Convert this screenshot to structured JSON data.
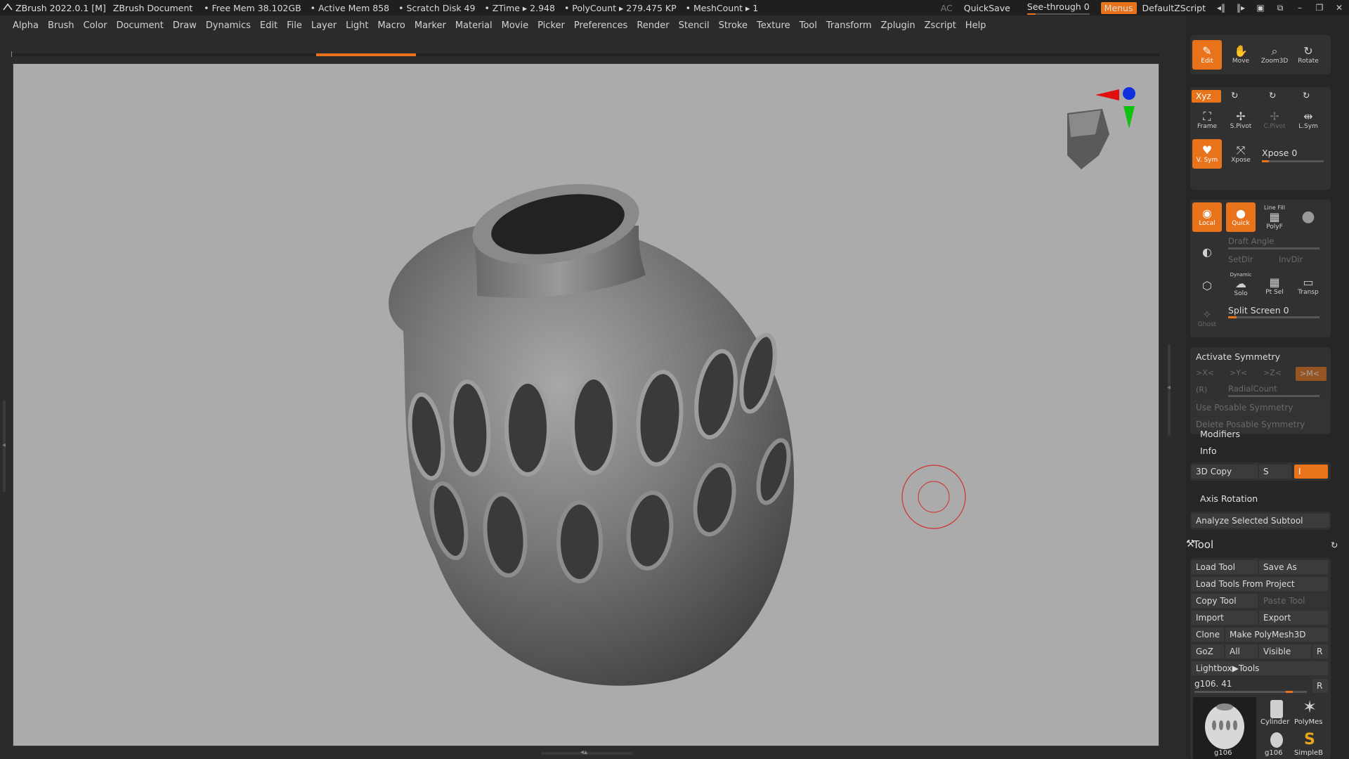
{
  "titlebar": {
    "app": "ZBrush 2022.0.1 [M]",
    "document": "ZBrush Document",
    "stats": [
      "• Free Mem 38.102GB",
      "• Active Mem 858",
      "• Scratch Disk 49",
      "• ZTime ▸ 2.948",
      "• PolyCount ▸ 279.475 KP",
      "• MeshCount ▸ 1"
    ],
    "ac": "AC",
    "quicksave": "QuickSave",
    "seethrough": "See-through  0",
    "menus": "Menus",
    "script": "DefaultZScript"
  },
  "menubar": {
    "items": [
      "Alpha",
      "Brush",
      "Color",
      "Document",
      "Draw",
      "Dynamics",
      "Edit",
      "File",
      "Layer",
      "Light",
      "Macro",
      "Marker",
      "Material",
      "Movie",
      "Picker",
      "Preferences",
      "Render",
      "Stencil",
      "Stroke",
      "Texture",
      "Tool",
      "Transform",
      "Zplugin",
      "Zscript",
      "Help"
    ]
  },
  "progress": {
    "value": 0.087
  },
  "palette": {
    "nav": {
      "edit": "Edit",
      "move": "Move",
      "zoom3d": "Zoom3D",
      "rotate": "Rotate"
    },
    "xyz": "Xyz",
    "frame": "Frame",
    "spivot": "S.Pivot",
    "cpivot": "C.Pivot",
    "lsym": "L.Sym",
    "vsym": "V. Sym",
    "xpose_btn": "Xpose",
    "xpose_label": "Xpose 0",
    "local": "Local",
    "quick": "Quick",
    "linefill": "Line Fill",
    "polyf": "PolyF",
    "draft_angle": "Draft Angle",
    "setdir": "SetDir",
    "invdir": "InvDir",
    "dynamic": "Dynamic",
    "solo": "Solo",
    "ptsel": "Pt Sel",
    "transp": "Transp",
    "ghost": "Ghost",
    "split_screen": "Split Screen 0",
    "symmetry": {
      "activate": "Activate Symmetry",
      "x": ">X<",
      "y": ">Y<",
      "z": ">Z<",
      "m": ">M<",
      "r": "(R)",
      "radial": "RadialCount",
      "use_posable": "Use Posable Symmetry",
      "delete_posable": "Delete Posable Symmetry"
    },
    "modifiers": "Modifiers",
    "info": "Info",
    "copy3d": "3D Copy",
    "s": "S",
    "i": "I",
    "axis_rotation": "Axis Rotation",
    "analyze": "Analyze Selected Subtool",
    "tool": {
      "title": "Tool",
      "load_tool": "Load Tool",
      "save_as": "Save As",
      "load_from_project": "Load Tools From Project",
      "copy_tool": "Copy Tool",
      "paste_tool": "Paste Tool",
      "import": "Import",
      "export": "Export",
      "clone": "Clone",
      "make_polymesh": "Make PolyMesh3D",
      "goz": "GoZ",
      "all": "All",
      "visible": "Visible",
      "r": "R",
      "lightbox": "Lightbox▶Tools",
      "current": "g106. 41",
      "thumbs": [
        "Cylinder",
        "PolyMes",
        "g106",
        "g106",
        "SimpleB"
      ]
    }
  },
  "colors": {
    "accent": "#e8731a",
    "viewport": "#ababab",
    "panel": "#262626"
  }
}
